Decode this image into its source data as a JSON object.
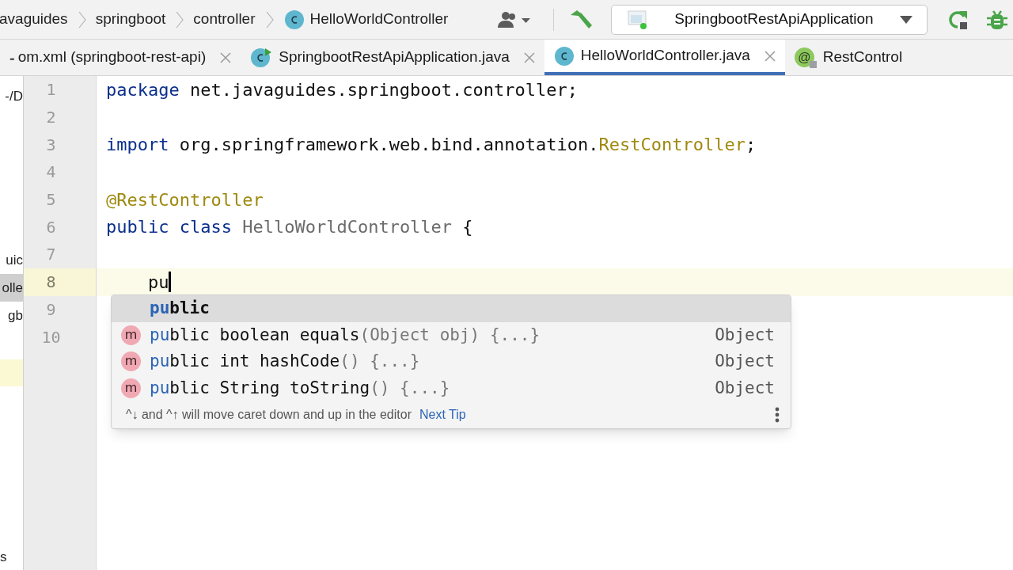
{
  "breadcrumbs": [
    {
      "text": "avaguides",
      "kind": "folder"
    },
    {
      "text": "springboot",
      "kind": "folder"
    },
    {
      "text": "controller",
      "kind": "folder"
    },
    {
      "text": "HelloWorldController",
      "kind": "class"
    }
  ],
  "run_config": {
    "label": "SpringbootRestApiApplication"
  },
  "tabs_overflow": "-",
  "tabs": [
    {
      "label": "om.xml (springboot-rest-api)",
      "kind": "file",
      "selected": false,
      "closable": true
    },
    {
      "label": "SpringbootRestApiApplication.java",
      "kind": "runnable-class",
      "selected": false,
      "closable": true
    },
    {
      "label": "HelloWorldController.java",
      "kind": "class",
      "selected": true,
      "closable": true
    },
    {
      "label": "RestControl",
      "kind": "annotation",
      "badge": "@",
      "selected": false,
      "closable": false
    }
  ],
  "sidebar": {
    "items": [
      {
        "text": "-/D",
        "selected": false
      },
      {
        "text": "uic",
        "selected": false
      },
      {
        "text": "olle",
        "selected": true
      },
      {
        "text": "gb",
        "selected": false
      }
    ],
    "bottom": "s"
  },
  "editor": {
    "lines": [
      {
        "number": "1",
        "current": false,
        "tokens": [
          {
            "text": "package",
            "kind": "keyword"
          },
          {
            "text": " net.javaguides.springboot.controller;",
            "kind": "plain"
          }
        ]
      },
      {
        "number": "2",
        "current": false
      },
      {
        "number": "3",
        "current": false,
        "tokens": [
          {
            "text": "import",
            "kind": "keyword"
          },
          {
            "text": " org.springframework.web.bind.annotation.",
            "kind": "plain"
          },
          {
            "text": "RestController",
            "kind": "annotation"
          },
          {
            "text": ";",
            "kind": "plain"
          }
        ]
      },
      {
        "number": "4",
        "current": false
      },
      {
        "number": "5",
        "current": false,
        "tokens": [
          {
            "text": "@RestController",
            "kind": "annotation"
          }
        ]
      },
      {
        "number": "6",
        "current": false,
        "tokens": [
          {
            "text": "public class",
            "kind": "keyword"
          },
          {
            "text": " HelloWorldController",
            "kind": "class"
          },
          {
            "text": " {",
            "kind": "plain"
          }
        ]
      },
      {
        "number": "7",
        "current": false
      },
      {
        "number": "8",
        "current": true,
        "tokens": [
          {
            "text": "    pu",
            "kind": "plain"
          }
        ]
      },
      {
        "number": "9",
        "current": false
      },
      {
        "number": "10",
        "current": false
      }
    ]
  },
  "completion": {
    "items": [
      {
        "kind": "keyword",
        "match": "pu",
        "name": "blic",
        "selected": true
      },
      {
        "kind": "method",
        "badge": "m",
        "match": "pu",
        "name": "blic boolean equals",
        "params": "(Object obj) {...}",
        "type": "Object",
        "selected": false
      },
      {
        "kind": "method",
        "badge": "m",
        "match": "pu",
        "name": "blic int hashCode",
        "params": "() {...}",
        "type": "Object",
        "selected": false
      },
      {
        "kind": "method",
        "badge": "m",
        "match": "pu",
        "name": "blic String toString",
        "params": "() {...}",
        "type": "Object",
        "selected": false
      }
    ],
    "tip": "^↓ and ^↑ will move caret down and up in the editor",
    "tip_link": "Next Tip"
  }
}
